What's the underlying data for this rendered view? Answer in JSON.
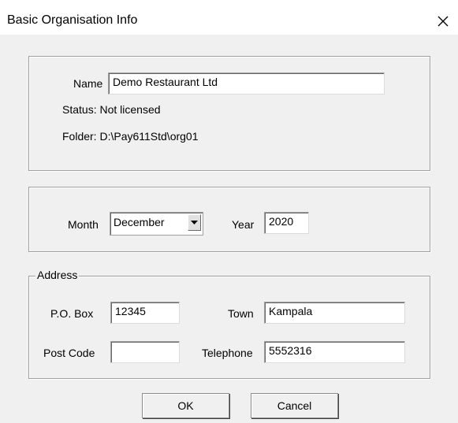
{
  "window": {
    "title": "Basic Organisation Info",
    "close_glyph": "✕"
  },
  "org": {
    "name_label": "Name",
    "name_value": "Demo Restaurant Ltd",
    "status_text": "Status: Not licensed",
    "folder_text": "Folder: D:\\Pay611Std\\org01"
  },
  "period": {
    "month_label": "Month",
    "month_value": "December",
    "year_label": "Year",
    "year_value": "2020"
  },
  "address": {
    "legend": "Address",
    "pobox_label": "P.O. Box",
    "pobox_value": "12345",
    "town_label": "Town",
    "town_value": "Kampala",
    "postcode_label": "Post Code",
    "postcode_value": "",
    "telephone_label": "Telephone",
    "telephone_value": "5552316"
  },
  "buttons": {
    "ok_label": "OK",
    "cancel_label": "Cancel"
  }
}
